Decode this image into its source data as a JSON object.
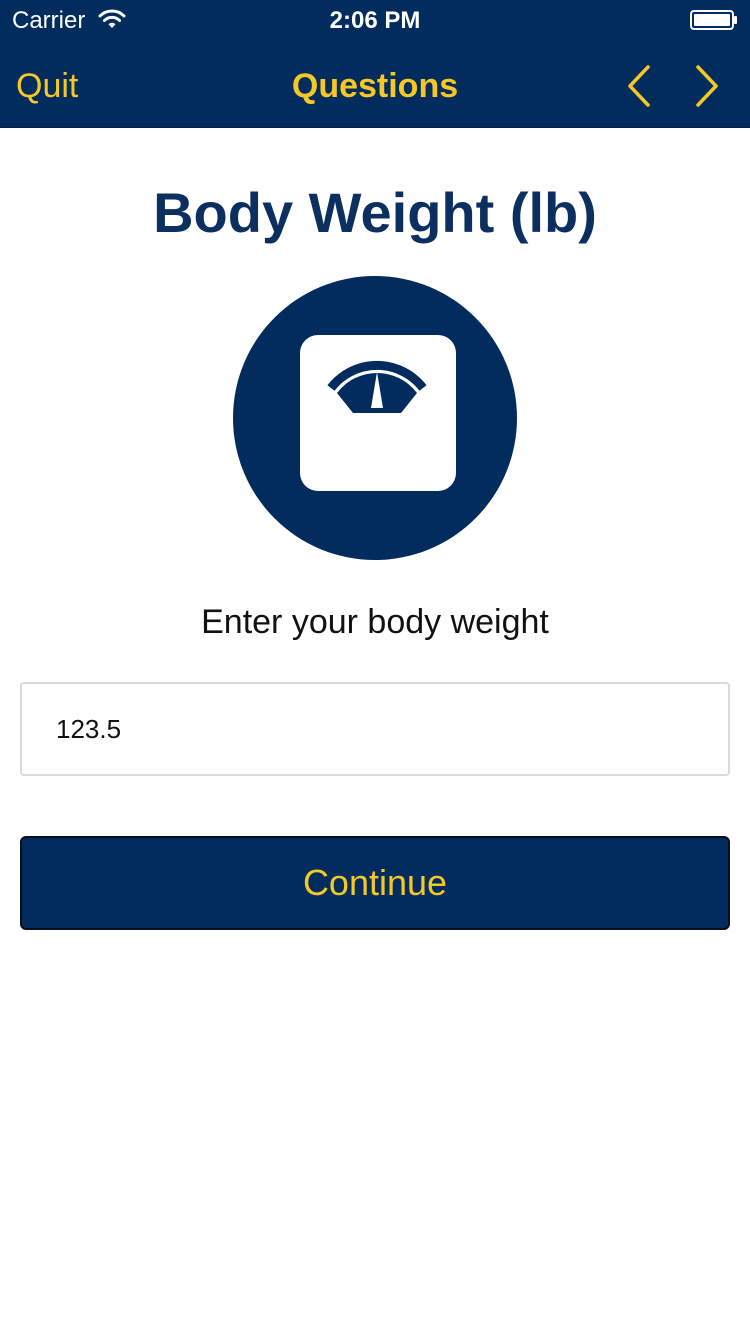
{
  "status_bar": {
    "carrier": "Carrier",
    "time": "2:06 PM"
  },
  "nav": {
    "quit_label": "Quit",
    "title": "Questions",
    "prev_icon": "chevron-left-icon",
    "next_icon": "chevron-right-icon"
  },
  "question": {
    "title": "Body Weight (lb)",
    "icon": "scale-icon",
    "prompt": "Enter your body weight",
    "value": "123.5",
    "continue_label": "Continue"
  },
  "colors": {
    "navy": "#022c5e",
    "accent": "#f6c825",
    "background": "#ffffff"
  }
}
